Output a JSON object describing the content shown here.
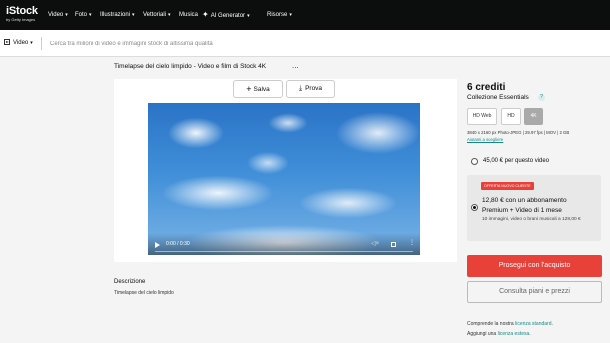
{
  "brand": {
    "name": "iStock",
    "tagline": "by Getty Images"
  },
  "nav": {
    "items": [
      {
        "label": "Video"
      },
      {
        "label": "Foto"
      },
      {
        "label": "Illustrazioni"
      },
      {
        "label": "Vettoriali"
      },
      {
        "label": "Musica"
      },
      {
        "label": "AI Generator"
      },
      {
        "label": "Risorse"
      }
    ],
    "dropdown_chevron": "▾"
  },
  "search": {
    "media_type": "Video",
    "placeholder": "Cerca tra milioni di video e immagini stock di altissima qualità"
  },
  "asset": {
    "title": "Timelapse del cielo limpido - Video e film di Stock 4K",
    "more": "...",
    "save_label": "Salva",
    "try_label": "Prova",
    "description_label": "Descrizione",
    "description": "Timelapse del cielo limpido"
  },
  "player": {
    "time": "0:00 / 0:30",
    "progress": 0
  },
  "purchase": {
    "credits": "6 crediti",
    "collection": "Collezione Essentials",
    "help": "?",
    "resolutions": [
      {
        "label": "HD Web",
        "selected": false
      },
      {
        "label": "HD",
        "selected": false
      },
      {
        "label": "4K",
        "selected": true
      }
    ],
    "specs": "3840 x 2160 px Photo-JPEG | 29.97 fps | MOV | 2 GB",
    "help_link": "Aiutami a scegliere",
    "single": {
      "label": "45,00 € per questo video",
      "selected": false
    },
    "subscription": {
      "badge": "OFFERTA NUOVO CLIENTE",
      "price": "12,80 € con un abbonamento",
      "plan": "Premium + Video di 1 mese",
      "detail": "10 immagini, video o brani musicali a 128,00 €",
      "selected": true
    },
    "buy_label": "Prosegui con l'acquisto",
    "plans_label": "Consulta piani e prezzi",
    "footer1_prefix": "Comprende la nostra",
    "footer1_link": "licenza standard",
    "footer1_suffix": ".",
    "footer2_prefix": "Aggiungi una",
    "footer2_link": "licenza estesa",
    "footer2_suffix": "."
  },
  "colors": {
    "topbar": "#0c0d0d",
    "accent": "#e8413a",
    "link": "#188a86",
    "page_bg": "#f4f4f4"
  }
}
